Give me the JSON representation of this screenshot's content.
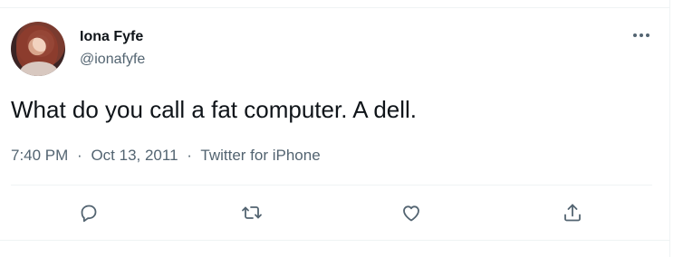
{
  "tweet": {
    "author_name": "Iona Fyfe",
    "author_handle": "@ionafyfe",
    "text": "What do you call a fat computer. A dell.",
    "time": "7:40 PM",
    "date": "Oct 13, 2011",
    "source": "Twitter for iPhone",
    "separator": "·"
  },
  "icons": {
    "more": "more-horizontal-icon",
    "reply": "reply-icon",
    "retweet": "retweet-icon",
    "like": "heart-icon",
    "share": "share-icon"
  },
  "colors": {
    "text_primary": "#0f1419",
    "text_secondary": "#536471",
    "border": "#eff3f4"
  }
}
